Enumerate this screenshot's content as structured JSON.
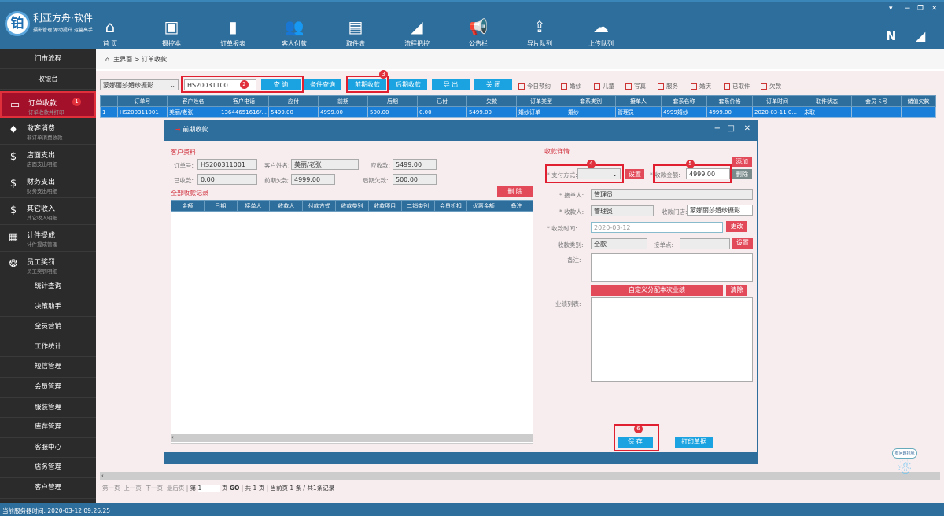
{
  "app": {
    "brand": "利亚方舟·软件",
    "slogan": "摄影管理 源动提升 运营高手",
    "logo_char": "铂"
  },
  "topnav": [
    {
      "label": "首 页",
      "icon": "home-icon",
      "glyph": "⌂"
    },
    {
      "label": "摄控本",
      "icon": "notebook-icon",
      "glyph": "▣"
    },
    {
      "label": "订单报表",
      "icon": "bar-chart-icon",
      "glyph": "▮"
    },
    {
      "label": "客人付款",
      "icon": "users-icon",
      "glyph": "👥"
    },
    {
      "label": "取件表",
      "icon": "cabinet-icon",
      "glyph": "▤"
    },
    {
      "label": "流程把控",
      "icon": "signal-icon",
      "glyph": "◢"
    },
    {
      "label": "公告栏",
      "icon": "megaphone-icon",
      "glyph": "📢"
    },
    {
      "label": "导片队列",
      "icon": "upload-window-icon",
      "glyph": "⇪"
    },
    {
      "label": "上传队列",
      "icon": "cloud-upload-icon",
      "glyph": "☁"
    }
  ],
  "window_controls": [
    "▾",
    "−",
    "❐",
    "✕"
  ],
  "sidebar": {
    "top": [
      "门市流程",
      "收银台"
    ],
    "big": [
      {
        "title": "订单收款",
        "sub": "订单收款并打印",
        "icon": "money-icon",
        "glyph": "▭",
        "selected": true,
        "badge": "1"
      },
      {
        "title": "散客消费",
        "sub": "非订单消费收款",
        "icon": "money-bag-icon",
        "glyph": "♦"
      },
      {
        "title": "店面支出",
        "sub": "店面支出明细",
        "icon": "coins-icon",
        "glyph": "$"
      },
      {
        "title": "财务支出",
        "sub": "财务支出明细",
        "icon": "coins-icon",
        "glyph": "$"
      },
      {
        "title": "其它收入",
        "sub": "其它收入明细",
        "icon": "money-bag-icon",
        "glyph": "$"
      },
      {
        "title": "计件提成",
        "sub": "计件提成管理",
        "icon": "abacus-icon",
        "glyph": "▦"
      },
      {
        "title": "员工奖罚",
        "sub": "员工奖罚明细",
        "icon": "medal-icon",
        "glyph": "❂"
      }
    ],
    "bottom": [
      "统计查询",
      "决策助手",
      "全员营销",
      "工作统计",
      "短信管理",
      "会员管理",
      "服装管理",
      "库存管理",
      "客服中心",
      "店务管理",
      "客户管理"
    ]
  },
  "breadcrumb": {
    "home": "主界面",
    "sep": ">",
    "current": "订单收款"
  },
  "toolbar": {
    "store": "蒙娜丽莎婚纱摄影",
    "search_value": "HS200311001",
    "query": "查 询",
    "cond_query": "条件查询",
    "pre_pay": "前期收款",
    "post_pay": "后期收款",
    "export": "导 出",
    "close": "关 闭",
    "checkboxes": [
      "今日预约",
      "婚纱",
      "儿童",
      "写真",
      "服务",
      "婚庆",
      "已取件",
      "欠款"
    ]
  },
  "badges": [
    "2",
    "3",
    "4",
    "5",
    "6"
  ],
  "orders": {
    "columns": [
      "",
      "订单号",
      "客户姓名",
      "客户电话",
      "应付",
      "前期",
      "后期",
      "已付",
      "欠款",
      "订单类型",
      "套系类别",
      "接单人",
      "套系名称",
      "套系价格",
      "订单时间",
      "取件状态",
      "会员卡号",
      "储值欠款"
    ],
    "rows": [
      [
        "1",
        "HS200311001",
        "美丽/老张",
        "13644651616/...",
        "5499.00",
        "4999.00",
        "500.00",
        "0.00",
        "5499.00",
        "婚纱订单",
        "婚纱",
        "管理员",
        "4999婚纱",
        "4999.00",
        "2020-03-11 0...",
        "未取",
        "",
        ""
      ]
    ]
  },
  "dialog": {
    "title": "前期收款",
    "controls": [
      "−",
      "□",
      "✕"
    ],
    "customer": {
      "section": "客户资料",
      "order_no_label": "订单号:",
      "order_no": "HS200311001",
      "name_label": "客户姓名:",
      "name": "美丽/老张",
      "due_label": "应收款:",
      "due": "5499.00",
      "paid_label": "已收款:",
      "paid": "0.00",
      "pre_owe_label": "前期欠款:",
      "pre_owe": "4999.00",
      "post_owe_label": "后期欠款:",
      "post_owe": "500.00"
    },
    "records": {
      "section": "全部收款记录",
      "delete": "删 除",
      "columns": [
        "金额",
        "日期",
        "接单人",
        "收款人",
        "付款方式",
        "收款类别",
        "收款项目",
        "二销类别",
        "会员折扣",
        "优惠金额",
        "备注"
      ]
    },
    "detail": {
      "section": "收款详情",
      "pay_method_label": "* 支付方式:",
      "set1": "设置",
      "amount_label": "* 收款金额:",
      "amount": "4999.00",
      "add": "添加",
      "remove": "删除",
      "taker_label": "* 接单人:",
      "taker": "管理员",
      "receiver_label": "* 收款人:",
      "receiver": "管理员",
      "store_label": "收款门店:",
      "store": "蒙娜丽莎婚纱摄影",
      "time_label": "* 收款时间:",
      "time": "2020-03-12",
      "change": "更改",
      "type_label": "收款类别:",
      "type": "全款",
      "point_label": "接单点:",
      "set2": "设置",
      "note_label": "备注:",
      "custom": "自定义分配本次业绩",
      "clear": "清除",
      "perf_label": "业绩列表:"
    },
    "save": "保 存",
    "print": "打印单据"
  },
  "pager": {
    "first": "第一页",
    "prev": "上一页",
    "next": "下一页",
    "last": "最后页",
    "page_label": "第",
    "page": "1",
    "page_unit": "页",
    "go": "GO",
    "total": "共 1 页",
    "current": "当前页 1 条 / 共1条记录"
  },
  "status": "当前服务器时间: 2020-03-12 09:26:25",
  "mascot_text": "有问题找我"
}
